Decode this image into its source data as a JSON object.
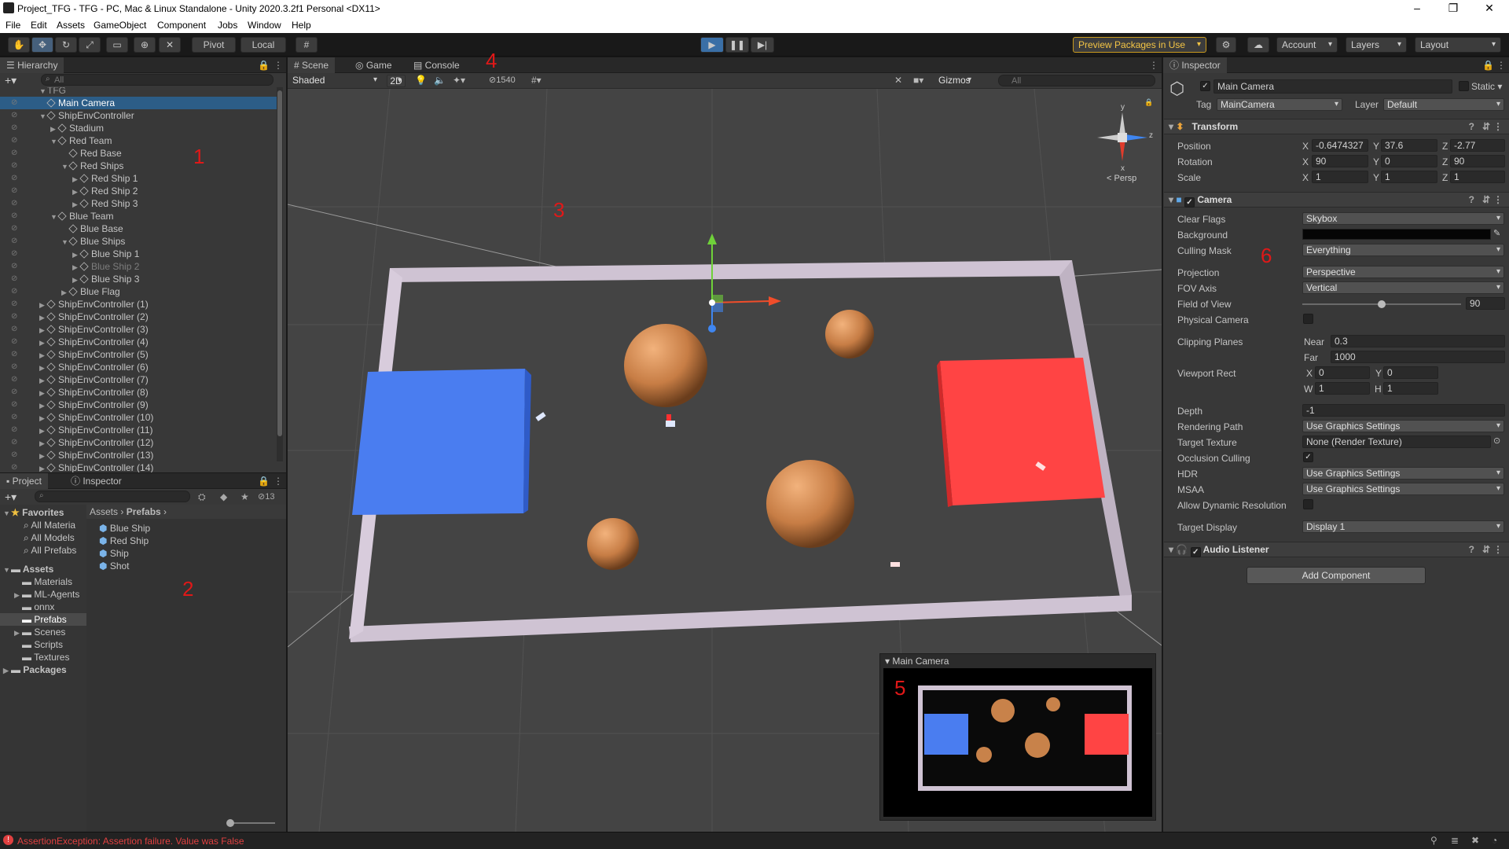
{
  "window": {
    "title": "Project_TFG - TFG - PC, Mac & Linux Standalone - Unity 2020.3.2f1 Personal <DX11>",
    "minimize": "–",
    "maximize": "❐",
    "close": "✕"
  },
  "menu": [
    "File",
    "Edit",
    "Assets",
    "GameObject",
    "Component",
    "Jobs",
    "Window",
    "Help"
  ],
  "toolbar": {
    "pivot": "Pivot",
    "local": "Local",
    "preview_packages": "Preview Packages in Use",
    "account": "Account",
    "layers": "Layers",
    "layout": "Layout"
  },
  "hierarchy": {
    "tab": "Hierarchy",
    "search_placeholder": "All",
    "partial_top": "TFG",
    "items": [
      {
        "label": "Main Camera",
        "indent": 1,
        "arrow": "",
        "selected": true
      },
      {
        "label": "ShipEnvController",
        "indent": 1,
        "arrow": "▼"
      },
      {
        "label": "Stadium",
        "indent": 2,
        "arrow": "▶"
      },
      {
        "label": "Red Team",
        "indent": 2,
        "arrow": "▼"
      },
      {
        "label": "Red Base",
        "indent": 3,
        "arrow": ""
      },
      {
        "label": "Red Ships",
        "indent": 3,
        "arrow": "▼"
      },
      {
        "label": "Red Ship 1",
        "indent": 4,
        "arrow": "▶"
      },
      {
        "label": "Red Ship 2",
        "indent": 4,
        "arrow": "▶"
      },
      {
        "label": "Red Ship 3",
        "indent": 4,
        "arrow": "▶"
      },
      {
        "label": "Blue Team",
        "indent": 2,
        "arrow": "▼"
      },
      {
        "label": "Blue Base",
        "indent": 3,
        "arrow": ""
      },
      {
        "label": "Blue Ships",
        "indent": 3,
        "arrow": "▼"
      },
      {
        "label": "Blue Ship 1",
        "indent": 4,
        "arrow": "▶"
      },
      {
        "label": "Blue Ship 2",
        "indent": 4,
        "arrow": "▶",
        "dim": true
      },
      {
        "label": "Blue Ship 3",
        "indent": 4,
        "arrow": "▶"
      },
      {
        "label": "Blue Flag",
        "indent": 3,
        "arrow": "▶"
      },
      {
        "label": "ShipEnvController (1)",
        "indent": 1,
        "arrow": "▶"
      },
      {
        "label": "ShipEnvController (2)",
        "indent": 1,
        "arrow": "▶"
      },
      {
        "label": "ShipEnvController (3)",
        "indent": 1,
        "arrow": "▶"
      },
      {
        "label": "ShipEnvController (4)",
        "indent": 1,
        "arrow": "▶"
      },
      {
        "label": "ShipEnvController (5)",
        "indent": 1,
        "arrow": "▶"
      },
      {
        "label": "ShipEnvController (6)",
        "indent": 1,
        "arrow": "▶"
      },
      {
        "label": "ShipEnvController (7)",
        "indent": 1,
        "arrow": "▶"
      },
      {
        "label": "ShipEnvController (8)",
        "indent": 1,
        "arrow": "▶"
      },
      {
        "label": "ShipEnvController (9)",
        "indent": 1,
        "arrow": "▶"
      },
      {
        "label": "ShipEnvController (10)",
        "indent": 1,
        "arrow": "▶"
      },
      {
        "label": "ShipEnvController (11)",
        "indent": 1,
        "arrow": "▶"
      },
      {
        "label": "ShipEnvController (12)",
        "indent": 1,
        "arrow": "▶"
      },
      {
        "label": "ShipEnvController (13)",
        "indent": 1,
        "arrow": "▶"
      },
      {
        "label": "ShipEnvController (14)",
        "indent": 1,
        "arrow": "▶"
      }
    ]
  },
  "project": {
    "tabs": [
      "Project",
      "Inspector"
    ],
    "count": "13",
    "favorites": {
      "label": "Favorites",
      "items": [
        "All Materia",
        "All Models",
        "All Prefabs"
      ]
    },
    "assets": {
      "label": "Assets",
      "items": [
        "Materials",
        "ML-Agents",
        "onnx",
        "Prefabs",
        "Scenes",
        "Scripts",
        "Textures"
      ]
    },
    "packages": "Packages",
    "breadcrumb": [
      "Assets",
      "Prefabs"
    ],
    "files": [
      "Blue Ship",
      "Red Ship",
      "Ship",
      "Shot"
    ]
  },
  "scene": {
    "tabs": [
      "Scene",
      "Game",
      "Console"
    ],
    "shading": "Shaded",
    "mode_2d": "2D",
    "hidden_count": "1540",
    "gizmos": "Gizmos",
    "search_placeholder": "All",
    "persp": "Persp",
    "axis_y": "y",
    "axis_z": "z",
    "axis_x": "x",
    "preview_title": "Main Camera"
  },
  "annotations": [
    "1",
    "2",
    "3",
    "4",
    "5",
    "6"
  ],
  "inspector": {
    "tab": "Inspector",
    "object_name": "Main Camera",
    "static": "Static",
    "tag_label": "Tag",
    "tag": "MainCamera",
    "layer_label": "Layer",
    "layer": "Default",
    "transform": {
      "title": "Transform",
      "position_label": "Position",
      "position": [
        "-0.6474327",
        "37.6",
        "-2.77"
      ],
      "rotation_label": "Rotation",
      "rotation": [
        "90",
        "0",
        "90"
      ],
      "scale_label": "Scale",
      "scale": [
        "1",
        "1",
        "1"
      ]
    },
    "camera": {
      "title": "Camera",
      "clear_flags_label": "Clear Flags",
      "clear_flags": "Skybox",
      "background_label": "Background",
      "culling_mask_label": "Culling Mask",
      "culling_mask": "Everything",
      "projection_label": "Projection",
      "projection": "Perspective",
      "fov_axis_label": "FOV Axis",
      "fov_axis": "Vertical",
      "fov_label": "Field of View",
      "fov": "90",
      "physical_label": "Physical Camera",
      "clipping_label": "Clipping Planes",
      "near_label": "Near",
      "near": "0.3",
      "far_label": "Far",
      "far": "1000",
      "viewport_label": "Viewport Rect",
      "vx": "0",
      "vy": "0",
      "vw": "1",
      "vh": "1",
      "depth_label": "Depth",
      "depth": "-1",
      "rendering_label": "Rendering Path",
      "rendering": "Use Graphics Settings",
      "target_texture_label": "Target Texture",
      "target_texture": "None (Render Texture)",
      "occlusion_label": "Occlusion Culling",
      "hdr_label": "HDR",
      "hdr": "Use Graphics Settings",
      "msaa_label": "MSAA",
      "msaa": "Use Graphics Settings",
      "dynres_label": "Allow Dynamic Resolution",
      "target_display_label": "Target Display",
      "target_display": "Display 1"
    },
    "audio": {
      "title": "Audio Listener"
    },
    "add_component": "Add Component"
  },
  "status": {
    "error": "AssertionException: Assertion failure. Value was False"
  },
  "colors": {
    "selection": "#2c5d87",
    "error": "#e04040",
    "annotation": "#e01818",
    "red_base": "#ff4444",
    "blue_base": "#4a7df0",
    "sphere": "#c8824a"
  }
}
